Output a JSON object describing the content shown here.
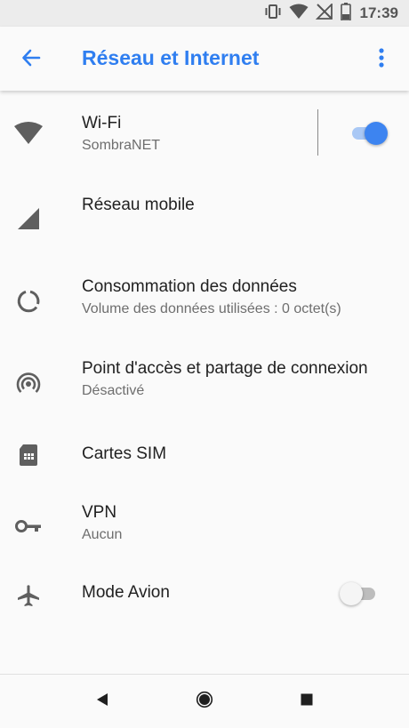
{
  "status_bar": {
    "time": "17:39",
    "icons": [
      "vibrate-icon",
      "wifi-icon",
      "no-signal-icon",
      "battery-icon"
    ]
  },
  "app_bar": {
    "title": "Réseau et Internet",
    "back_icon": "arrow-back-icon",
    "overflow_icon": "more-vert-icon"
  },
  "accent_color": "#2f7ef0",
  "items": [
    {
      "title": "Wi-Fi",
      "subtitle": "SombraNET",
      "icon": "wifi-icon",
      "toggle": true
    },
    {
      "title": "Réseau mobile",
      "subtitle": "",
      "icon": "cell-signal-icon"
    },
    {
      "title": "Consommation des données",
      "subtitle": "Volume des données utilisées : 0 octet(s)",
      "icon": "data-usage-icon"
    },
    {
      "title": "Point d'accès et partage de connexion",
      "subtitle": "Désactivé",
      "icon": "hotspot-icon"
    },
    {
      "title": "Cartes SIM",
      "subtitle": "",
      "icon": "sim-card-icon"
    },
    {
      "title": "VPN",
      "subtitle": "Aucun",
      "icon": "vpn-key-icon"
    },
    {
      "title": "Mode Avion",
      "subtitle": "",
      "icon": "airplane-icon",
      "toggle": false
    }
  ],
  "nav_bar": {
    "icons": [
      "nav-back-icon",
      "nav-home-icon",
      "nav-recents-icon"
    ]
  }
}
